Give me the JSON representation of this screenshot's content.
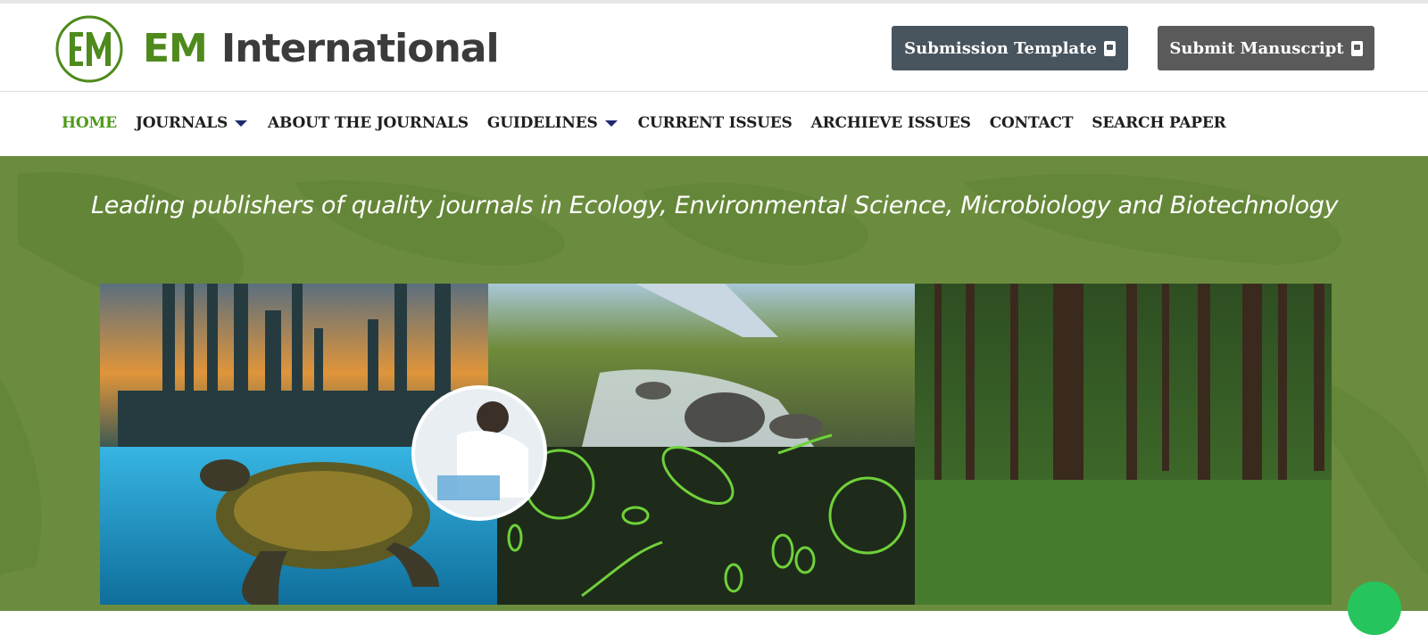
{
  "header": {
    "logo_alt": "EM",
    "brand_em": "EM",
    "brand_rest": "International",
    "buttons": {
      "template_label": "Submission Template",
      "submit_label": "Submit Manuscript"
    }
  },
  "nav": {
    "items": [
      {
        "label": "HOME",
        "active": true
      },
      {
        "label": "JOURNALS",
        "dropdown": true
      },
      {
        "label": "ABOUT THE JOURNALS"
      },
      {
        "label": "GUIDELINES",
        "dropdown": true
      },
      {
        "label": "CURRENT ISSUES"
      },
      {
        "label": "ARCHIEVE ISSUES"
      },
      {
        "label": "CONTACT"
      },
      {
        "label": "SEARCH PAPER"
      }
    ]
  },
  "hero": {
    "tagline": "Leading publishers of quality journals in Ecology, Environmental Science, Microbiology and Biotechnology"
  },
  "colors": {
    "brand_green": "#4e8a1c",
    "nav_active": "#4f9a1a",
    "hero_bg": "#6b8c3e",
    "template_btn": "#48555f",
    "submit_btn": "#5a5a5a"
  },
  "icons": [
    "logo-em",
    "book-icon",
    "caret-down-icon",
    "whatsapp-icon"
  ]
}
